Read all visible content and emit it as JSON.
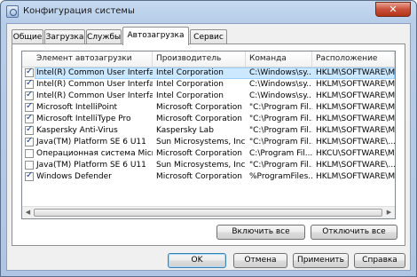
{
  "window": {
    "title": "Конфигурация системы",
    "close_symbol": "✕"
  },
  "tabs": [
    {
      "label": "Общие"
    },
    {
      "label": "Загрузка"
    },
    {
      "label": "Службы"
    },
    {
      "label": "Автозагрузка"
    },
    {
      "label": "Сервис"
    }
  ],
  "active_tab": "Автозагрузка",
  "list": {
    "columns": [
      "Элемент автозагрузки",
      "Производитель",
      "Команда",
      "Расположение"
    ],
    "rows": [
      {
        "checked": true,
        "item": "Intel(R) Common User Interface",
        "vendor": "Intel Corporation",
        "command": "C:\\Windows\\sy...",
        "location": "HKLM\\SOFTWARE\\M...",
        "selected": true
      },
      {
        "checked": true,
        "item": "Intel(R) Common User Interface",
        "vendor": "Intel Corporation",
        "command": "C:\\Windows\\sy...",
        "location": "HKLM\\SOFTWARE\\M..."
      },
      {
        "checked": true,
        "item": "Intel(R) Common User Interface",
        "vendor": "Intel Corporation",
        "command": "C:\\Windows\\sy...",
        "location": "HKLM\\SOFTWARE\\M..."
      },
      {
        "checked": true,
        "item": "Microsoft IntelliPoint",
        "vendor": "Microsoft Corporation",
        "command": "\"C:\\Program Fil...",
        "location": "HKLM\\SOFTWARE\\M..."
      },
      {
        "checked": true,
        "item": "Microsoft IntelliType Pro",
        "vendor": "Microsoft Corporation",
        "command": "\"C:\\Program Fil...",
        "location": "HKLM\\SOFTWARE\\M..."
      },
      {
        "checked": true,
        "item": "Kaspersky Anti-Virus",
        "vendor": "Kaspersky Lab",
        "command": "\"C:\\Program Fil...",
        "location": "HKLM\\SOFTWARE\\M..."
      },
      {
        "checked": true,
        "item": "Java(TM) Platform SE 6 U11",
        "vendor": "Sun Microsystems, Inc.",
        "command": "\"C:\\Program Fil...",
        "location": "HKLM\\SOFTWARE\\..."
      },
      {
        "checked": false,
        "item": "Операционная система Micro...",
        "vendor": "Microsoft Corporation",
        "command": "C:\\Program Fil...",
        "location": "HKCU\\SOFTWARE\\M..."
      },
      {
        "checked": false,
        "item": "Java(TM) Platform SE 6 U11",
        "vendor": "Sun Microsystems, Inc.",
        "command": "\"C:\\Program Fil...",
        "location": "HKLM\\SOFTWARE\\..."
      },
      {
        "checked": true,
        "item": "Windows Defender",
        "vendor": "Microsoft Corporation",
        "command": "%ProgramFiles...",
        "location": "HKLM\\SOFTWARE\\M..."
      }
    ],
    "checkmark": "✓",
    "scroll_left": "◀",
    "scroll_right": "▶"
  },
  "panel_buttons": {
    "enable_all": "Включить все",
    "disable_all": "Отключить все"
  },
  "dialog_buttons": {
    "ok": "OK",
    "cancel": "Отмена",
    "apply": "Применить",
    "help": "Справка"
  }
}
